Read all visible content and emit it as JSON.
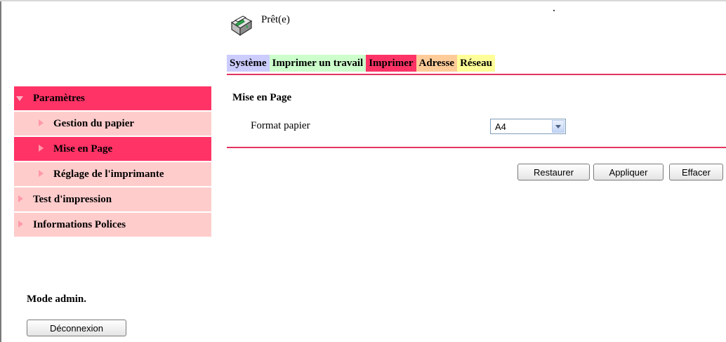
{
  "status": {
    "text": "Prêt(e)",
    "icon": "printer-icon"
  },
  "tabs": [
    {
      "label": "Système",
      "color": "#ccccff"
    },
    {
      "label": "Imprimer un travail",
      "color": "#ccffcc"
    },
    {
      "label": "Imprimer",
      "color": "#ff3366"
    },
    {
      "label": "Adresse",
      "color": "#ffcc99"
    },
    {
      "label": "Réseau",
      "color": "#ffff99"
    }
  ],
  "sidebar": {
    "items": [
      {
        "label": "Paramètres"
      },
      {
        "label": "Gestion du papier"
      },
      {
        "label": "Mise en Page"
      },
      {
        "label": "Réglage de l'imprimante"
      },
      {
        "label": "Test d'impression"
      },
      {
        "label": "Informations Polices"
      }
    ],
    "admin_mode": "Mode admin.",
    "logout_label": "Déconnexion"
  },
  "main": {
    "section_title": "Mise en Page",
    "field_label": "Format papier",
    "field_value": "A4"
  },
  "buttons": {
    "restore": "Restaurer",
    "apply": "Appliquer",
    "clear": "Effacer"
  },
  "colors": {
    "accent": "#ff3366",
    "sidebar_light": "#ffcccc",
    "divider": "#e2345f"
  }
}
